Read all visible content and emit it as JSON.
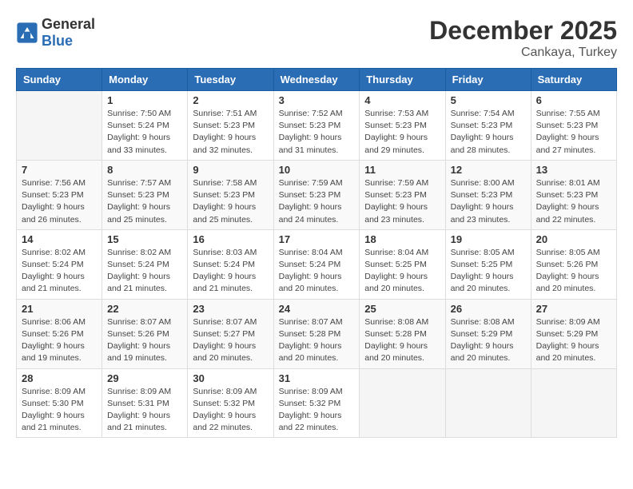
{
  "header": {
    "logo_general": "General",
    "logo_blue": "Blue",
    "title": "December 2025",
    "subtitle": "Cankaya, Turkey"
  },
  "weekdays": [
    "Sunday",
    "Monday",
    "Tuesday",
    "Wednesday",
    "Thursday",
    "Friday",
    "Saturday"
  ],
  "weeks": [
    [
      {
        "day": "",
        "info": ""
      },
      {
        "day": "1",
        "info": "Sunrise: 7:50 AM\nSunset: 5:24 PM\nDaylight: 9 hours\nand 33 minutes."
      },
      {
        "day": "2",
        "info": "Sunrise: 7:51 AM\nSunset: 5:23 PM\nDaylight: 9 hours\nand 32 minutes."
      },
      {
        "day": "3",
        "info": "Sunrise: 7:52 AM\nSunset: 5:23 PM\nDaylight: 9 hours\nand 31 minutes."
      },
      {
        "day": "4",
        "info": "Sunrise: 7:53 AM\nSunset: 5:23 PM\nDaylight: 9 hours\nand 29 minutes."
      },
      {
        "day": "5",
        "info": "Sunrise: 7:54 AM\nSunset: 5:23 PM\nDaylight: 9 hours\nand 28 minutes."
      },
      {
        "day": "6",
        "info": "Sunrise: 7:55 AM\nSunset: 5:23 PM\nDaylight: 9 hours\nand 27 minutes."
      }
    ],
    [
      {
        "day": "7",
        "info": "Sunrise: 7:56 AM\nSunset: 5:23 PM\nDaylight: 9 hours\nand 26 minutes."
      },
      {
        "day": "8",
        "info": "Sunrise: 7:57 AM\nSunset: 5:23 PM\nDaylight: 9 hours\nand 25 minutes."
      },
      {
        "day": "9",
        "info": "Sunrise: 7:58 AM\nSunset: 5:23 PM\nDaylight: 9 hours\nand 25 minutes."
      },
      {
        "day": "10",
        "info": "Sunrise: 7:59 AM\nSunset: 5:23 PM\nDaylight: 9 hours\nand 24 minutes."
      },
      {
        "day": "11",
        "info": "Sunrise: 7:59 AM\nSunset: 5:23 PM\nDaylight: 9 hours\nand 23 minutes."
      },
      {
        "day": "12",
        "info": "Sunrise: 8:00 AM\nSunset: 5:23 PM\nDaylight: 9 hours\nand 23 minutes."
      },
      {
        "day": "13",
        "info": "Sunrise: 8:01 AM\nSunset: 5:23 PM\nDaylight: 9 hours\nand 22 minutes."
      }
    ],
    [
      {
        "day": "14",
        "info": "Sunrise: 8:02 AM\nSunset: 5:24 PM\nDaylight: 9 hours\nand 21 minutes."
      },
      {
        "day": "15",
        "info": "Sunrise: 8:02 AM\nSunset: 5:24 PM\nDaylight: 9 hours\nand 21 minutes."
      },
      {
        "day": "16",
        "info": "Sunrise: 8:03 AM\nSunset: 5:24 PM\nDaylight: 9 hours\nand 21 minutes."
      },
      {
        "day": "17",
        "info": "Sunrise: 8:04 AM\nSunset: 5:24 PM\nDaylight: 9 hours\nand 20 minutes."
      },
      {
        "day": "18",
        "info": "Sunrise: 8:04 AM\nSunset: 5:25 PM\nDaylight: 9 hours\nand 20 minutes."
      },
      {
        "day": "19",
        "info": "Sunrise: 8:05 AM\nSunset: 5:25 PM\nDaylight: 9 hours\nand 20 minutes."
      },
      {
        "day": "20",
        "info": "Sunrise: 8:05 AM\nSunset: 5:26 PM\nDaylight: 9 hours\nand 20 minutes."
      }
    ],
    [
      {
        "day": "21",
        "info": "Sunrise: 8:06 AM\nSunset: 5:26 PM\nDaylight: 9 hours\nand 19 minutes."
      },
      {
        "day": "22",
        "info": "Sunrise: 8:07 AM\nSunset: 5:26 PM\nDaylight: 9 hours\nand 19 minutes."
      },
      {
        "day": "23",
        "info": "Sunrise: 8:07 AM\nSunset: 5:27 PM\nDaylight: 9 hours\nand 20 minutes."
      },
      {
        "day": "24",
        "info": "Sunrise: 8:07 AM\nSunset: 5:28 PM\nDaylight: 9 hours\nand 20 minutes."
      },
      {
        "day": "25",
        "info": "Sunrise: 8:08 AM\nSunset: 5:28 PM\nDaylight: 9 hours\nand 20 minutes."
      },
      {
        "day": "26",
        "info": "Sunrise: 8:08 AM\nSunset: 5:29 PM\nDaylight: 9 hours\nand 20 minutes."
      },
      {
        "day": "27",
        "info": "Sunrise: 8:09 AM\nSunset: 5:29 PM\nDaylight: 9 hours\nand 20 minutes."
      }
    ],
    [
      {
        "day": "28",
        "info": "Sunrise: 8:09 AM\nSunset: 5:30 PM\nDaylight: 9 hours\nand 21 minutes."
      },
      {
        "day": "29",
        "info": "Sunrise: 8:09 AM\nSunset: 5:31 PM\nDaylight: 9 hours\nand 21 minutes."
      },
      {
        "day": "30",
        "info": "Sunrise: 8:09 AM\nSunset: 5:32 PM\nDaylight: 9 hours\nand 22 minutes."
      },
      {
        "day": "31",
        "info": "Sunrise: 8:09 AM\nSunset: 5:32 PM\nDaylight: 9 hours\nand 22 minutes."
      },
      {
        "day": "",
        "info": ""
      },
      {
        "day": "",
        "info": ""
      },
      {
        "day": "",
        "info": ""
      }
    ]
  ]
}
